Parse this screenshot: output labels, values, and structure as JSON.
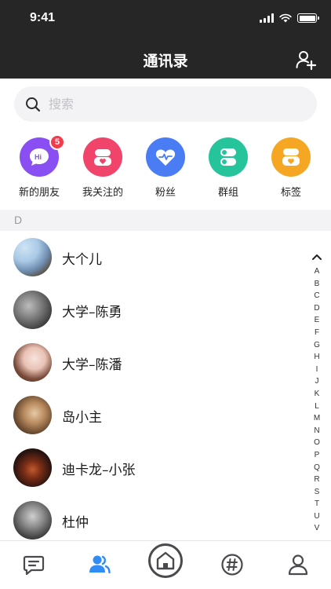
{
  "status_bar": {
    "time": "9:41"
  },
  "nav": {
    "title": "通讯录",
    "add_icon": "person-add-icon"
  },
  "search": {
    "placeholder": "搜索"
  },
  "shortcuts": [
    {
      "label": "新的朋友",
      "color": "#8a4ff2",
      "icon": "hi-chat-icon",
      "badge": "5"
    },
    {
      "label": "我关注的",
      "color": "#f0446a",
      "icon": "heart-person-icon"
    },
    {
      "label": "粉丝",
      "color": "#4a7cf3",
      "icon": "heart-pulse-icon"
    },
    {
      "label": "群组",
      "color": "#25c49a",
      "icon": "group-icon"
    },
    {
      "label": "标签",
      "color": "#f5a623",
      "icon": "tag-icon"
    }
  ],
  "section": {
    "letter": "D"
  },
  "contacts": [
    {
      "name": "大个儿"
    },
    {
      "name": "大学–陈勇"
    },
    {
      "name": "大学–陈潘"
    },
    {
      "name": "岛小主"
    },
    {
      "name": "迪卡龙–小张"
    },
    {
      "name": "杜仲"
    }
  ],
  "index_letters": [
    "A",
    "B",
    "C",
    "D",
    "E",
    "F",
    "G",
    "H",
    "I",
    "J",
    "K",
    "L",
    "M",
    "N",
    "O",
    "P",
    "Q",
    "R",
    "S",
    "T",
    "U",
    "V"
  ],
  "tab_bar": {
    "active_color": "#2f8df5",
    "inactive_color": "#4a4a4e",
    "tabs": [
      "messages-icon",
      "contacts-icon",
      "home-icon",
      "topics-icon",
      "profile-icon"
    ]
  }
}
